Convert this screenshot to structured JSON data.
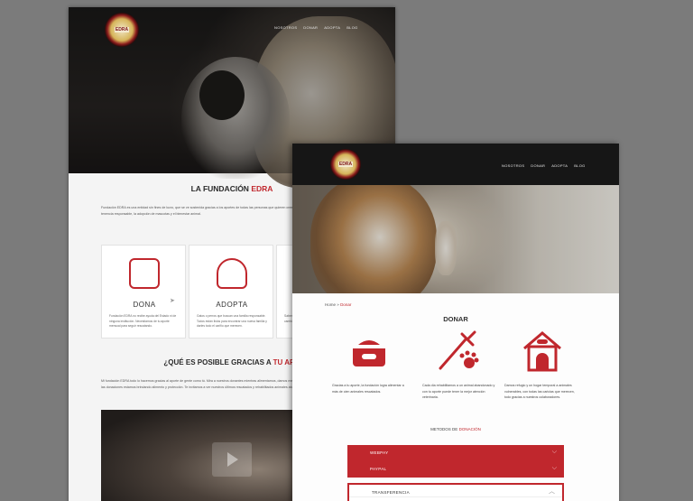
{
  "back_page": {
    "logo_text": "EDRA",
    "nav": [
      "NOSOTROS",
      "DONAR",
      "ADOPTA",
      "BLOG"
    ],
    "title_prefix": "LA FUNDACIÓN",
    "title_highlight": "EDRA",
    "intro": "Fundación EDRA es una entidad sin fines de lucro, que se ve sostenida gracias a los aportes de todas las personas que quieren creer en el rescate animal, la educación sobre la tenencia responsable, la adopción de mascotas y el bienestar animal.",
    "cards": [
      {
        "title": "DONA",
        "text": "Fundación EDRA no recibe ayuda del Estado ni de ninguna institución. Necesitamos de tu aporte mensual para seguir rescatando."
      },
      {
        "title": "ADOPTA",
        "text": "Gatos o perros que buscan una familia responsable. Todos están listos para encontrar una nueva familia y darles todo el cariño que merecen."
      },
      {
        "title": "V",
        "text": "Sabemos que tu aporte es importante y podemos cambiar su vida."
      }
    ],
    "question_prefix": "¿QUÉ ES POSIBLE GRACIAS A",
    "question_highlight": "TU APO",
    "question_text": "Mi fundación EDRA todo lo hacemos gracias al aporte de gente como tú. Mira a nuestros donantes mientras alimentamos, damos medicinas y vamos también con estos amigos. Con las donaciones estamos brindando alimento y protección. Te invitamos a ver nuestros últimos rescatados y rehabilitados animales abandonados."
  },
  "front_page": {
    "logo_text": "EDRA",
    "nav": [
      "NOSOTROS",
      "DONAR",
      "ADOPTA",
      "BLOG"
    ],
    "breadcrumb": {
      "home": "Home",
      "sep": "»",
      "current": "Donar"
    },
    "title": "DONAR",
    "icons": [
      "food-bowl-icon",
      "vaccine-paw-icon",
      "dog-house-icon"
    ],
    "features": [
      "Gracias a tu aporte, la fundación logra alimentar a más de cien animales rescatados.",
      "Cada día rehabilitamos a un animal abandonado y con tu aporte puede tener la mejor atención veterinaria.",
      "Damos refugio y un hogar temporal a animales vulnerables, con todas las caricias que merecen, todo gracias a nuestros colaboradores."
    ],
    "methods_prefix": "METODOS DE",
    "methods_highlight": "DONACIÓN",
    "accordion": [
      {
        "label": "WEBPAY",
        "expanded": false
      },
      {
        "label": "PAYPAL",
        "expanded": false
      },
      {
        "label": "TRANSFERENCIA",
        "expanded": true
      }
    ]
  },
  "colors": {
    "accent": "#c0272d",
    "header": "#161616",
    "backdrop": "#7b7b7b"
  }
}
